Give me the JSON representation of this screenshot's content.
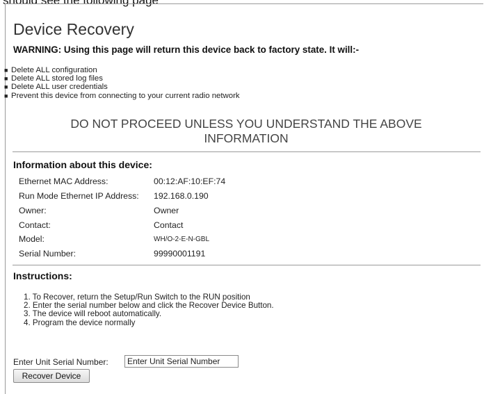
{
  "document": {
    "caption": "should see the following page"
  },
  "page": {
    "title": "Device Recovery",
    "warning": "WARNING: Using this page will return this device back to factory state. It will:-",
    "warning_items": [
      "Delete ALL configuration",
      "Delete ALL stored log files",
      "Delete ALL user credentials",
      "Prevent this device from connecting to your current radio network"
    ],
    "notice_line1": "DO NOT PROCEED UNLESS YOU UNDERSTAND THE ABOVE",
    "notice_line2": "INFORMATION"
  },
  "device_info": {
    "heading": "Information about this device:",
    "rows": [
      {
        "label": "Ethernet MAC Address:",
        "value": "00:12:AF:10:EF:74"
      },
      {
        "label": "Run Mode Ethernet IP Address:",
        "value": "192.168.0.190"
      },
      {
        "label": "Owner:",
        "value": "Owner"
      },
      {
        "label": "Contact:",
        "value": "Contact"
      },
      {
        "label": "Model:",
        "value": "WH/O-2-E-N-GBL"
      },
      {
        "label": "Serial Number:",
        "value": "99990001191"
      }
    ]
  },
  "instructions": {
    "heading": "Instructions:",
    "steps": [
      "1. To Recover, return the Setup/Run Switch to the RUN position",
      "2. Enter the serial number below and click the Recover Device Button.",
      "3. The device will reboot automatically.",
      "4. Program the device normally"
    ]
  },
  "form": {
    "serial_label": "Enter Unit Serial Number:",
    "serial_placeholder": "Enter Unit Serial Number",
    "recover_button": "Recover Device"
  }
}
